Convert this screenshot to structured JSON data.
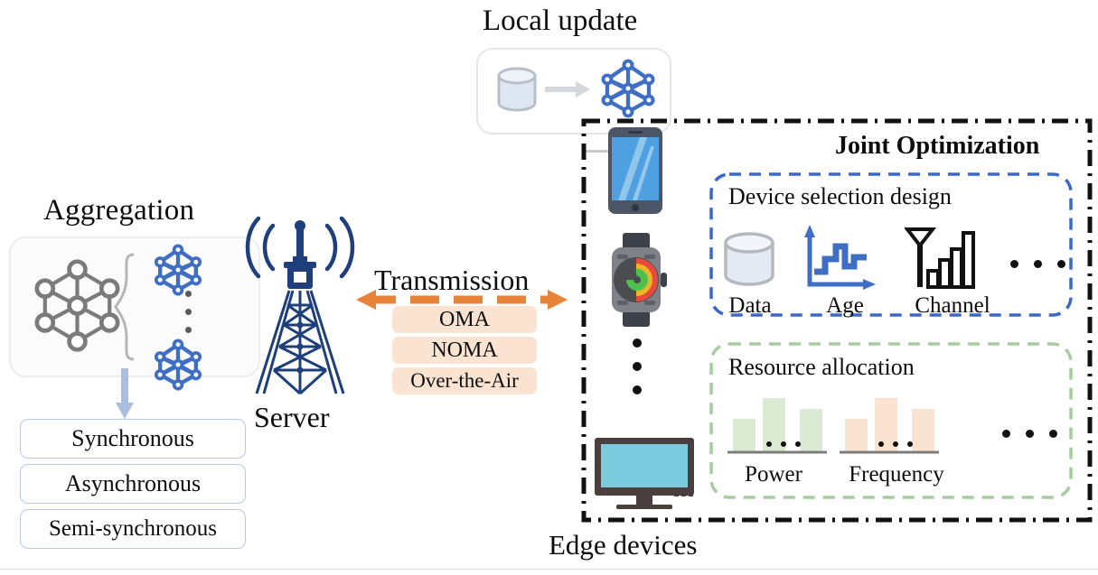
{
  "diagram": {
    "title_local_update": "Local update",
    "title_aggregation": "Aggregation",
    "title_server": "Server",
    "title_transmission": "Transmission",
    "title_joint_optimization": "Joint Optimization",
    "title_edge_devices": "Edge devices"
  },
  "aggregation": {
    "global_model_icon": "neural-network-gray",
    "client_model_icon": "neural-network-blue",
    "modes": [
      {
        "label": "Synchronous"
      },
      {
        "label": "Asynchronous"
      },
      {
        "label": "Semi-synchronous"
      }
    ]
  },
  "transmission": {
    "schemes": [
      {
        "label": "OMA"
      },
      {
        "label": "NOMA"
      },
      {
        "label": "Over-the-Air"
      }
    ]
  },
  "joint_optimization": {
    "device_selection": {
      "title": "Device selection design",
      "metrics": [
        {
          "label": "Data",
          "icon": "database-cylinder-icon"
        },
        {
          "label": "Age",
          "icon": "step-signal-chart-icon"
        },
        {
          "label": "Channel",
          "icon": "antenna-signal-bars-icon"
        }
      ],
      "ellipsis": "..."
    },
    "resource_allocation": {
      "title": "Resource allocation",
      "resources": [
        {
          "label": "Power",
          "icon": "green-bar-chart-icon",
          "bars": [
            42,
            78,
            0,
            62
          ]
        },
        {
          "label": "Frequency",
          "icon": "orange-bar-chart-icon",
          "bars": [
            42,
            78,
            0,
            62
          ]
        }
      ],
      "ellipsis": "..."
    }
  },
  "edge_devices": {
    "items": [
      {
        "icon": "smartphone-icon"
      },
      {
        "icon": "smartwatch-icon"
      },
      {
        "icon": "vertical-ellipsis"
      },
      {
        "icon": "desktop-monitor-icon"
      }
    ]
  },
  "colors": {
    "accent_orange": "#e8833a",
    "transmission_box": "#fbe3d2",
    "device_border_blue": "#3b68c4",
    "resource_border_green": "#a5ce9e",
    "model_blue": "#3f6fc4",
    "model_gray": "#7b7b7b",
    "sync_border": "#b9c9e4",
    "frame_black": "#111111"
  }
}
